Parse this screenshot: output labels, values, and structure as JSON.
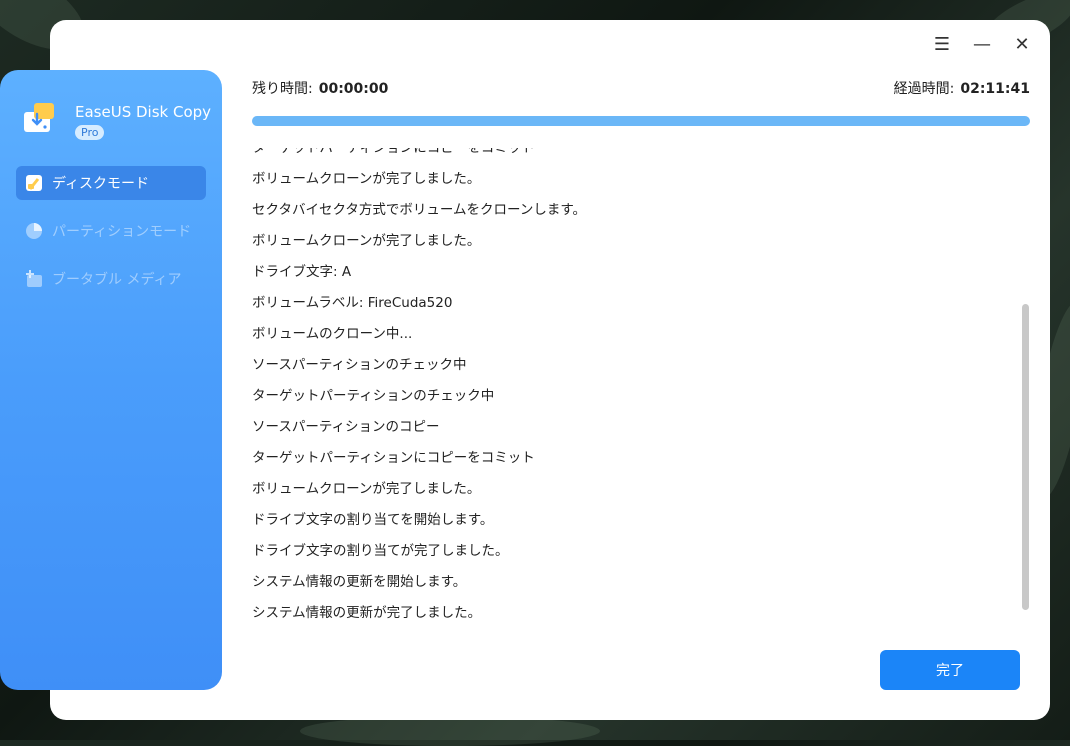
{
  "window": {
    "menu_icon": "hamburger-icon",
    "minimize_icon": "minimize-icon",
    "close_icon": "close-icon"
  },
  "brand": {
    "title": "EaseUS Disk Copy",
    "badge": "Pro"
  },
  "sidebar": {
    "items": [
      {
        "label": "ディスクモード",
        "icon": "disk-icon",
        "active": true
      },
      {
        "label": "パーティションモード",
        "icon": "pie-icon",
        "active": false
      },
      {
        "label": "ブータブル メディア",
        "icon": "bootable-media-icon",
        "active": false
      }
    ]
  },
  "status": {
    "remaining_label": "残り時間:",
    "remaining_value": "00:00:00",
    "elapsed_label": "経過時間:",
    "elapsed_value": "02:11:41",
    "progress": 1.0
  },
  "log": {
    "lines": [
      "ターゲットパーティションにコピーをコミット",
      "ボリュームクローンが完了しました。",
      "セクタバイセクタ方式でボリュームをクローンします。",
      "ボリュームクローンが完了しました。",
      "ドライブ文字: A",
      "ボリュームラベル: FireCuda520",
      "ボリュームのクローン中...",
      "ソースパーティションのチェック中",
      "ターゲットパーティションのチェック中",
      "ソースパーティションのコピー",
      "ターゲットパーティションにコピーをコミット",
      "ボリュームクローンが完了しました。",
      "ドライブ文字の割り当てを開始します。",
      "ドライブ文字の割り当てが完了しました。",
      "システム情報の更新を開始します。",
      "システム情報の更新が完了しました。"
    ]
  },
  "actions": {
    "done_label": "完了"
  },
  "colors": {
    "accent": "#1b85f8",
    "progress": "#6bb7f7",
    "sidebar_top": "#5db0ff",
    "sidebar_bottom": "#3f8ff7"
  }
}
